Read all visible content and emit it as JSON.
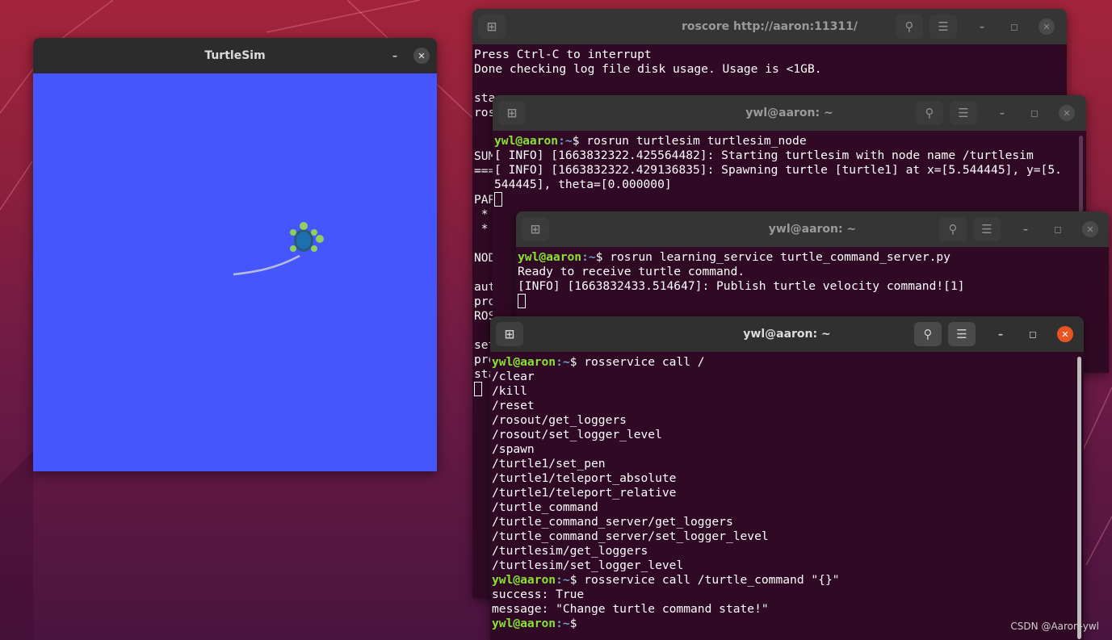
{
  "colors": {
    "turtle_bg": "#4556ff",
    "terminal_bg": "#300a24",
    "prompt_user": "#8ae234",
    "prompt_path": "#729fcf",
    "close_active": "#e95420"
  },
  "icons": {
    "new_tab": "new-tab-icon",
    "search": "search-icon",
    "menu": "hamburger-menu-icon",
    "minimize": "minimize-icon",
    "maximize": "maximize-icon",
    "close": "close-icon"
  },
  "turtlesim": {
    "title": "TurtleSim"
  },
  "roscore": {
    "title": "roscore http://aaron:11311/",
    "lines": [
      "Press Ctrl-C to interrupt",
      "Done checking log file disk usage. Usage is <1GB.",
      "",
      "sta",
      "ros",
      "",
      "",
      "SUM",
      "===",
      "",
      "PAR",
      " *",
      " *",
      "",
      "NOD",
      "",
      "aut",
      "pro",
      "ROS",
      "",
      "set",
      "pro",
      "sta"
    ]
  },
  "term2": {
    "title": "ywl@aaron: ~",
    "prompt_user": "ywl@aaron",
    "prompt_path": ":~",
    "command": "$ rosrun turtlesim turtlesim_node",
    "lines": [
      "[ INFO] [1663832322.425564482]: Starting turtlesim with node name /turtlesim",
      "[ INFO] [1663832322.429136835]: Spawning turtle [turtle1] at x=[5.544445], y=[5.",
      "544445], theta=[0.000000]"
    ]
  },
  "term3": {
    "title": "ywl@aaron: ~",
    "prompt_user": "ywl@aaron",
    "prompt_path": ":~",
    "command": "$ rosrun learning_service turtle_command_server.py",
    "lines": [
      "Ready to receive turtle command.",
      "[INFO] [1663832433.514647]: Publish turtle velocity command![1]"
    ]
  },
  "term4": {
    "title": "ywl@aaron: ~",
    "prompt_user": "ywl@aaron",
    "prompt_path": ":~",
    "command1": "$ rosservice call /",
    "services": [
      "/clear",
      "/kill",
      "/reset",
      "/rosout/get_loggers",
      "/rosout/set_logger_level",
      "/spawn",
      "/turtle1/set_pen",
      "/turtle1/teleport_absolute",
      "/turtle1/teleport_relative",
      "/turtle_command",
      "/turtle_command_server/get_loggers",
      "/turtle_command_server/set_logger_level",
      "/turtlesim/get_loggers",
      "/turtlesim/set_logger_level"
    ],
    "command2": "$ rosservice call /turtle_command \"{}\"",
    "result": [
      "success: True",
      "message: \"Change turtle command state!\""
    ],
    "command3": "$"
  },
  "watermark": "CSDN @Aaron-ywl"
}
